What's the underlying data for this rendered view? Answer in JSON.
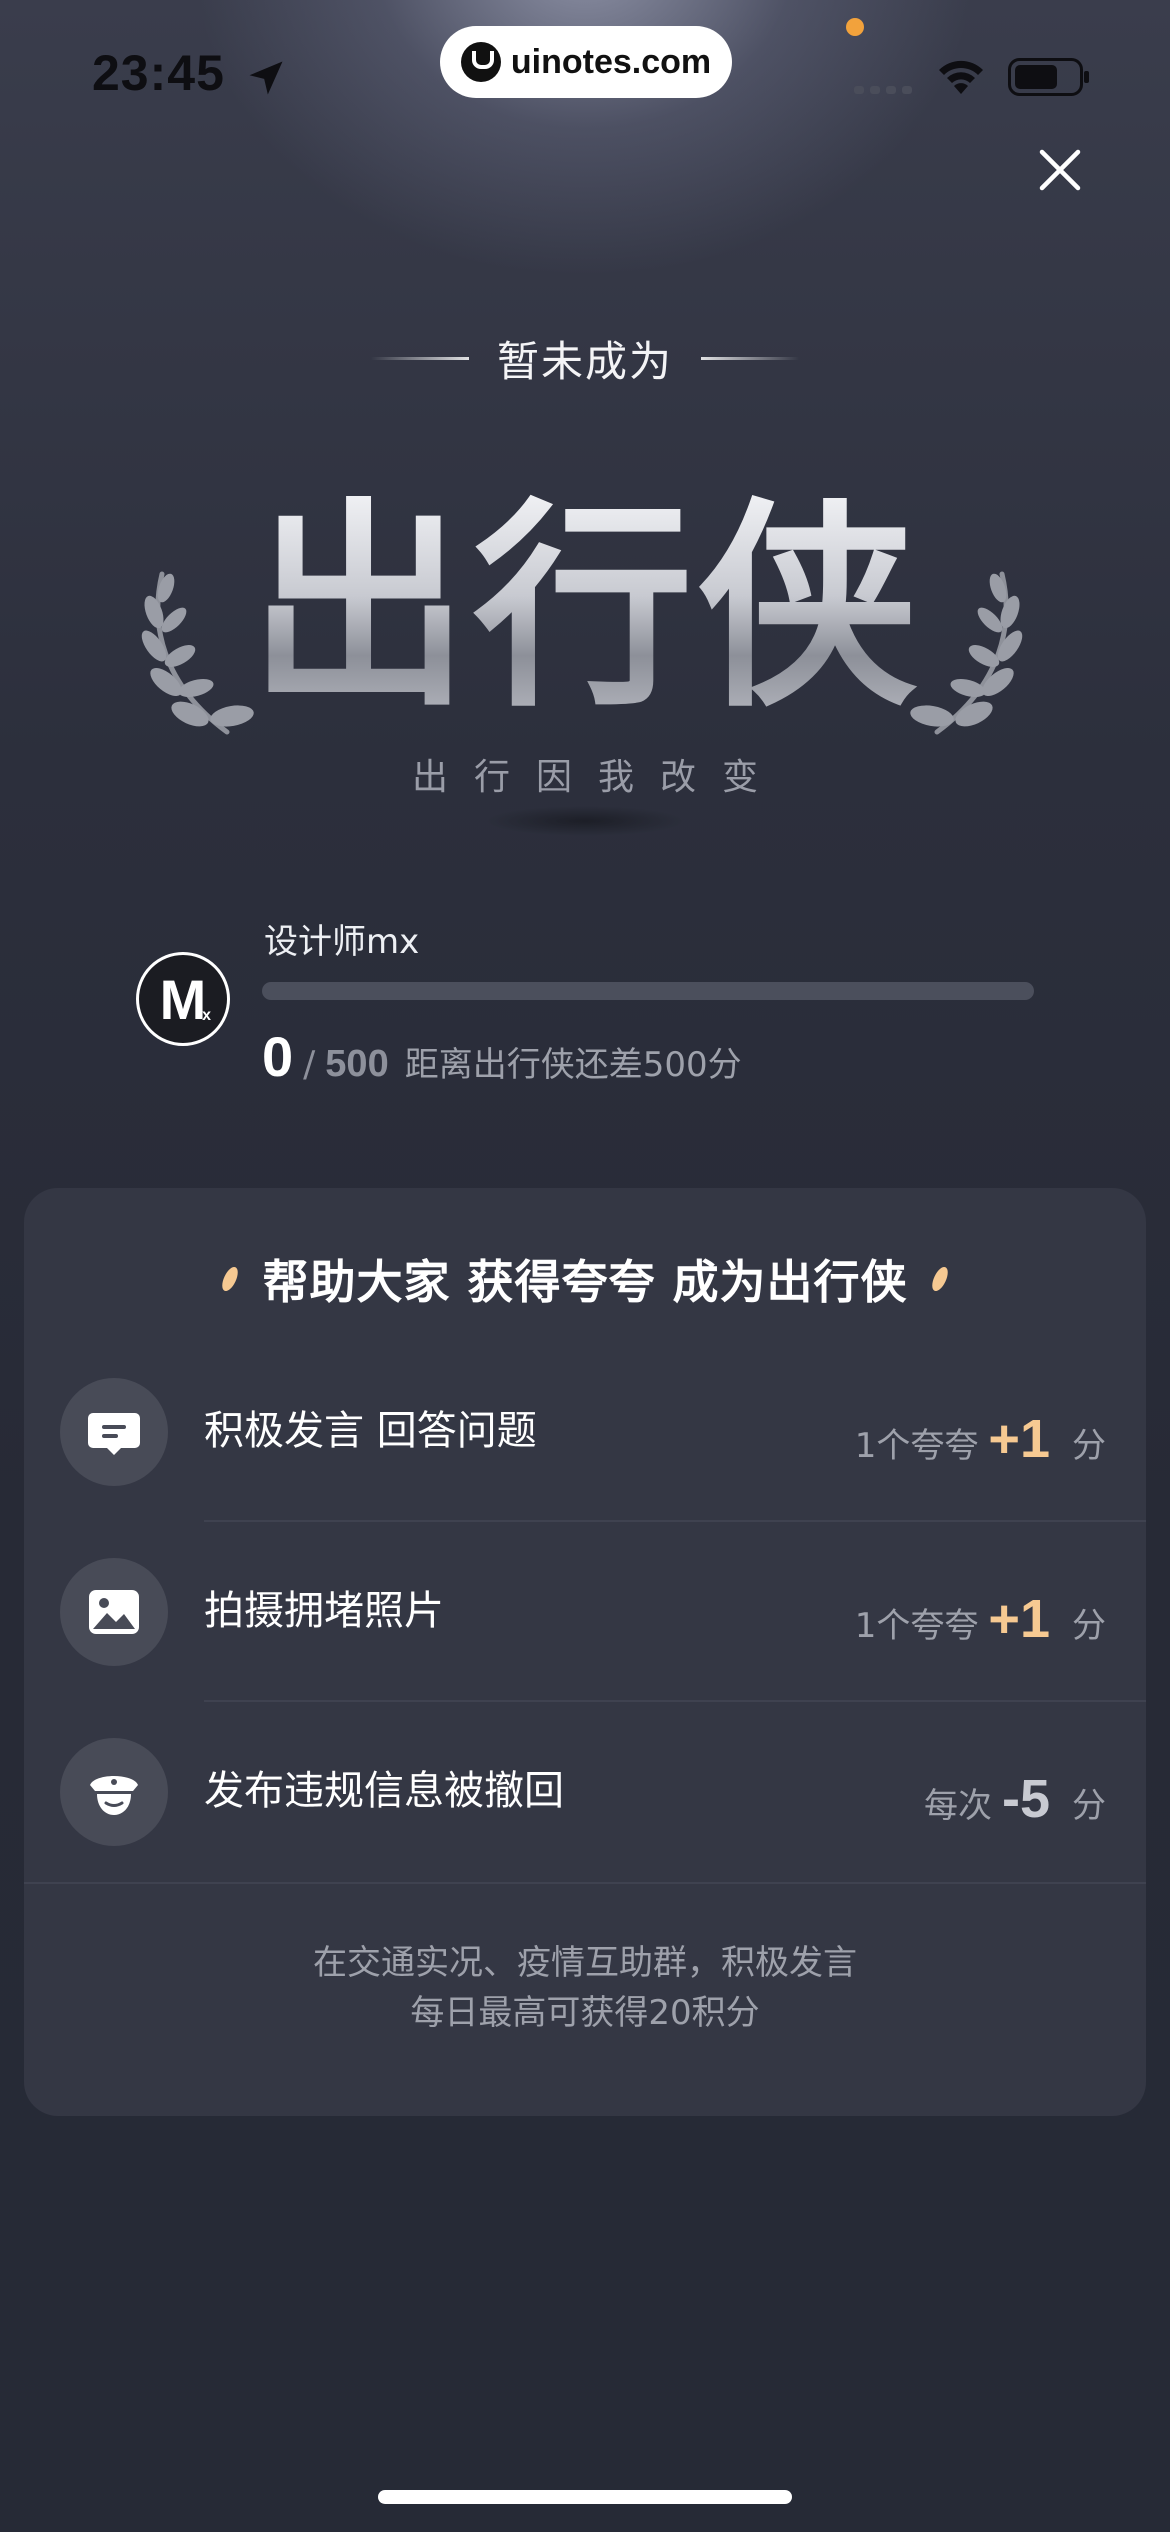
{
  "status_bar": {
    "time": "23:45",
    "url": "uinotes.com"
  },
  "hero": {
    "subtitle": "暂未成为",
    "title": "出行侠",
    "slogan": "出行因我改变"
  },
  "user": {
    "avatar_letter": "M",
    "avatar_sub": "x",
    "name": "设计师mx",
    "score_current": "0",
    "score_separator": "/",
    "score_total": "500",
    "score_hint": "距离出行侠还差500分",
    "progress_fraction": 0
  },
  "task_card": {
    "title": "帮助大家 获得夸夸 成为出行侠",
    "tasks": [
      {
        "icon": "chat-bubble-icon",
        "title": "积极发言 回答问题",
        "reward_label": "1个夸夸",
        "reward_points": "+1",
        "reward_unit": "分"
      },
      {
        "icon": "photo-icon",
        "title": "拍摄拥堵照片",
        "reward_label": "1个夸夸",
        "reward_points": "+1",
        "reward_unit": "分"
      },
      {
        "icon": "police-officer-icon",
        "title": "发布违规信息被撤回",
        "reward_label": "每次",
        "reward_points": "-5",
        "reward_unit": "分"
      }
    ],
    "footer_line1": "在交通实况、疫情互助群，积极发言",
    "footer_line2": "每日最高可获得20积分"
  },
  "colors": {
    "accent": "#f6c992",
    "background": "#262a36",
    "card": "#343744"
  }
}
